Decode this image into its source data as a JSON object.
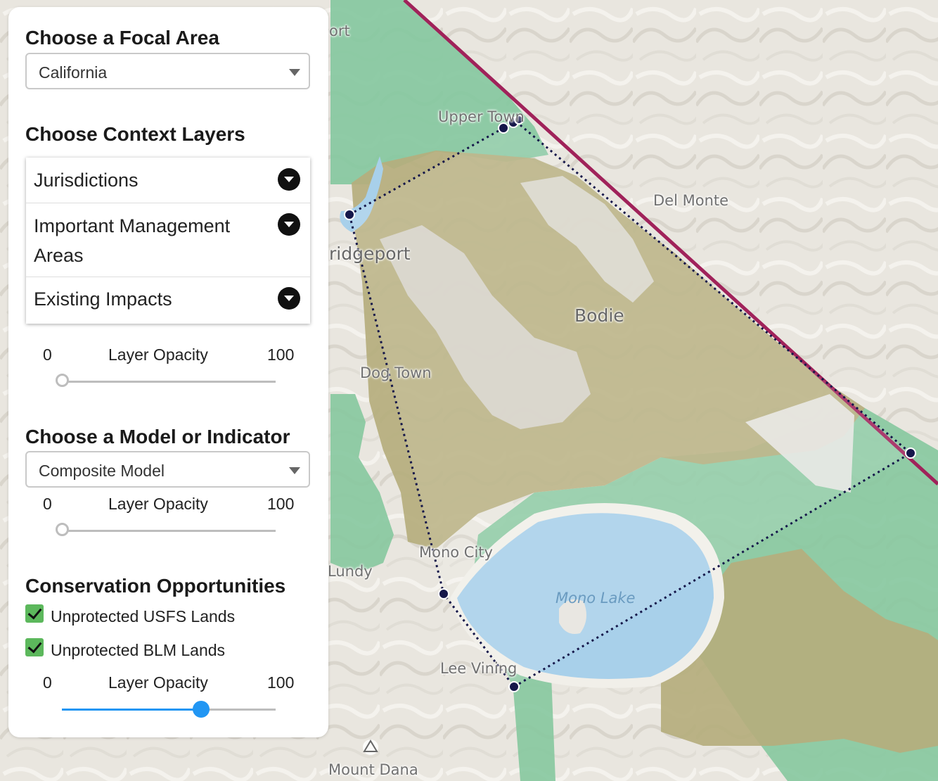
{
  "map": {
    "labels": {
      "upper_town": "Upper Town",
      "del_monte": "Del Monte",
      "bridgeport": "ridgeport",
      "bodie": "Bodie",
      "dog_town": "Dog Town",
      "mono_city": "Mono City",
      "lundy": "Lundy",
      "mono_lake": "Mono Lake",
      "lee_vining": "Lee Vining",
      "mount_dana": "Mount Dana",
      "top_fragment": "ort"
    },
    "colors": {
      "terrain": "#e9e6df",
      "usfs": "#7fc49a",
      "blm": "#b4ad7c",
      "water": "#a8d0ea",
      "state_line": "#a0225a",
      "polygon": "#15174a"
    }
  },
  "panel": {
    "focal_area": {
      "title": "Choose a Focal Area",
      "selected": "California"
    },
    "context_layers": {
      "title": "Choose Context Layers",
      "items": [
        {
          "label": "Jurisdictions"
        },
        {
          "label": "Important Management Areas"
        },
        {
          "label": "Existing Impacts"
        }
      ],
      "opacity": {
        "min": "0",
        "title": "Layer Opacity",
        "max": "100",
        "value": 0
      }
    },
    "model": {
      "title": "Choose a Model or Indicator",
      "selected": "Composite Model",
      "opacity": {
        "min": "0",
        "title": "Layer Opacity",
        "max": "100",
        "value": 0
      }
    },
    "conservation": {
      "title": "Conservation Opportunities",
      "options": [
        {
          "label": "Unprotected USFS Lands",
          "checked": true
        },
        {
          "label": "Unprotected BLM Lands",
          "checked": true
        }
      ],
      "opacity": {
        "min": "0",
        "title": "Layer Opacity",
        "max": "100",
        "value": 65
      }
    }
  }
}
